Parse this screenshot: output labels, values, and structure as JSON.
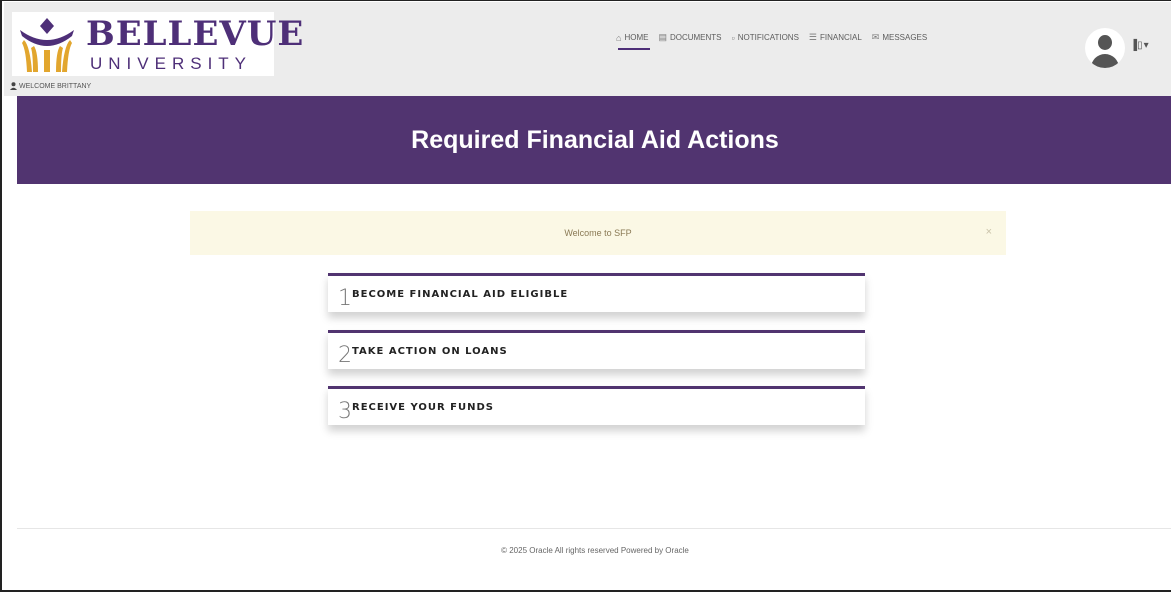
{
  "brand": {
    "name": "BELLEVUE",
    "subtitle": "UNIVERSITY"
  },
  "header": {
    "welcome": "WELCOME BRITTANY",
    "nav": [
      {
        "label": "HOME",
        "icon": "home-icon",
        "active": true
      },
      {
        "label": "DOCUMENTS",
        "icon": "document-icon",
        "active": false
      },
      {
        "label": "NOTIFICATIONS",
        "icon": "bell-icon",
        "active": false
      },
      {
        "label": "FINANCIAL",
        "icon": "money-icon",
        "active": false
      },
      {
        "label": "MESSAGES",
        "icon": "envelope-icon",
        "active": false
      }
    ],
    "user_menu": "▐▯"
  },
  "banner": {
    "title": "Required Financial Aid Actions"
  },
  "alert": {
    "text": "Welcome to SFP",
    "close": "×"
  },
  "steps": [
    {
      "number": "1",
      "label": "BECOME FINANCIAL AID ELIGIBLE"
    },
    {
      "number": "2",
      "label": "TAKE ACTION ON LOANS"
    },
    {
      "number": "3",
      "label": "RECEIVE YOUR FUNDS"
    }
  ],
  "footer": {
    "text": "© 2025 Oracle All rights reserved Powered by Oracle"
  },
  "colors": {
    "accent": "#513470",
    "header_bg": "#ececec",
    "alert_bg": "#fbf8e5"
  }
}
